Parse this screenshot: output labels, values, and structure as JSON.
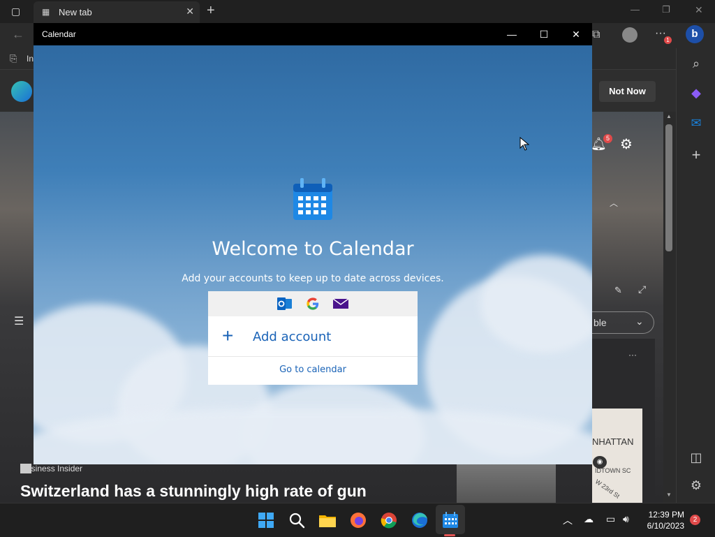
{
  "browser": {
    "tab_title": "New tab",
    "fav_item": "In",
    "banner_button": "Not Now",
    "notification_count": "5",
    "profile_badge": "1",
    "dropdown_partial": "ble",
    "news_source": "Business Insider",
    "news_headline": "Switzerland has a stunningly high rate of gun",
    "map_label_1": "NHATTAN",
    "map_label_2": "IDTOWN SC",
    "map_label_3": "W 23rd St",
    "more_label": "···"
  },
  "calendar_window": {
    "title": "Calendar",
    "welcome_title": "Welcome to Calendar",
    "welcome_subtitle": "Add your accounts to keep up to date across devices.",
    "providers": [
      "outlook-icon",
      "google-icon",
      "mail-icon"
    ],
    "add_account_label": "Add account",
    "go_to_calendar_label": "Go to calendar",
    "minimize_glyph": "—",
    "maximize_glyph": "☐",
    "close_glyph": "✕"
  },
  "taskbar": {
    "time": "12:39 PM",
    "date": "6/10/2023",
    "notification_count": "2",
    "apps": [
      "start-icon",
      "search-icon",
      "file-explorer-icon",
      "firefox-icon",
      "chrome-icon",
      "edge-icon",
      "calendar-icon"
    ]
  },
  "colors": {
    "accent": "#1a63b7",
    "calendar_blue": "#1e88e5",
    "titlebar": "#000000",
    "taskbar": "#1f1f1f"
  }
}
